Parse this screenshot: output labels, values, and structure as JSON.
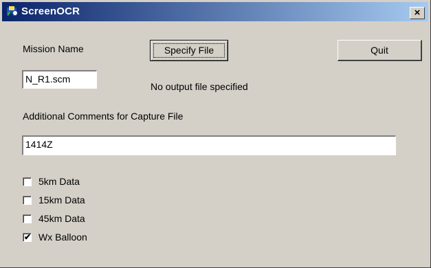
{
  "window": {
    "title": "ScreenOCR",
    "close_glyph": "×",
    "icon": "app-icon"
  },
  "mission": {
    "label": "Mission Name",
    "value": "N_R1.scm"
  },
  "buttons": {
    "specify_file": "Specify File",
    "quit": "Quit"
  },
  "output_status": "No output file specified",
  "comments": {
    "label": "Additional Comments for Capture File",
    "value": "1414Z"
  },
  "checkboxes": [
    {
      "label": "5km Data",
      "checked": false
    },
    {
      "label": "15km Data",
      "checked": false
    },
    {
      "label": "45km Data",
      "checked": false
    },
    {
      "label": "Wx Balloon",
      "checked": true
    }
  ],
  "check_glyph": "✔"
}
